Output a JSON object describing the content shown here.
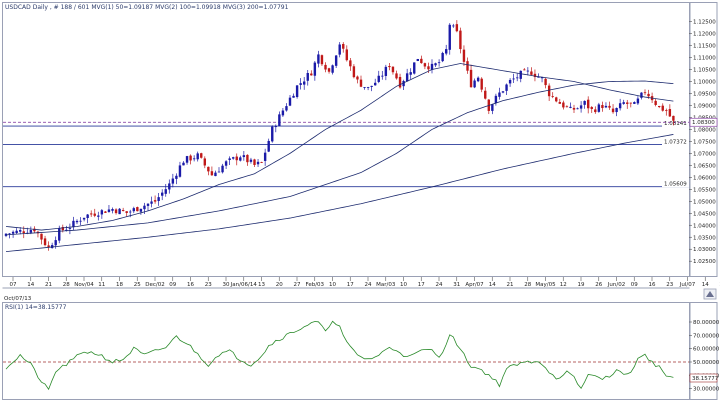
{
  "header": {
    "symbol": "USDCAD",
    "info": "Daily , # 188 / 601",
    "ma1": "MVG(1) 50=1.09187",
    "ma2": "MVG(2) 100=1.09918",
    "ma3": "MVG(3) 200=1.07791"
  },
  "colors": {
    "background": "#ffffff",
    "panel_border": "#9aa0b5",
    "up_candle": "#1a1aa8",
    "down_candle": "#c01818",
    "moving_average": "#1c2a6e",
    "support_line": "#2a3a9a",
    "current_price_dash": "#7a2a9a",
    "rsi_line": "#2a8a2a",
    "rsi_level_dash": "#a03030",
    "grid": "#d8dbe6"
  },
  "chart_data": [
    {
      "type": "candlestick",
      "name": "price",
      "ylim": [
        1.0205,
        1.129
      ],
      "y_ticks": [
        1.025,
        1.03,
        1.035,
        1.04,
        1.045,
        1.05,
        1.055,
        1.06,
        1.065,
        1.07,
        1.075,
        1.08,
        1.085,
        1.09,
        1.095,
        1.1,
        1.105,
        1.11,
        1.115,
        1.12,
        1.125
      ],
      "y_tick_labels": [
        "1.02500",
        "1.03000",
        "1.03500",
        "1.04000",
        "1.04500",
        "1.05000",
        "1.05500",
        "1.06000",
        "1.06500",
        "1.07000",
        "1.07500",
        "1.08000",
        "1.08500",
        "1.09000",
        "1.09500",
        "1.10000",
        "1.10500",
        "1.11000",
        "1.11500",
        "1.12000",
        "1.12500"
      ],
      "x_tick_labels": [
        "07",
        "14",
        "21",
        "28",
        "Nov/04",
        "11",
        "18",
        "25",
        "Dec/02",
        "09",
        "16",
        "23",
        "30",
        "Jan/06/14",
        "13",
        "20",
        "27",
        "Feb/03",
        "10",
        "17",
        "24",
        "Mar/03",
        "10",
        "17",
        "24",
        "31",
        "Apr/07",
        "14",
        "21",
        "28",
        "May/05",
        "12",
        "19",
        "26",
        "Jun/02",
        "09",
        "16",
        "23",
        "Jul/07",
        "14",
        "21",
        "28",
        "Aug/04"
      ],
      "x_tick_bar_spacing": 5,
      "x_range_label": "Oct/07/13",
      "grid": false,
      "last_price": 1.083,
      "last_price_label": "1.08300",
      "horizontal_levels": [
        {
          "value": 1.0814,
          "label": "1.08141"
        },
        {
          "value": 1.0737,
          "label": "1.07372"
        },
        {
          "value": 1.0561,
          "label": "1.05609"
        }
      ],
      "anchor_closes": [
        [
          0,
          1.0365
        ],
        [
          8,
          1.0385
        ],
        [
          12,
          1.0305
        ],
        [
          15,
          1.0375
        ],
        [
          18,
          1.0395
        ],
        [
          22,
          1.0438
        ],
        [
          26,
          1.0455
        ],
        [
          30,
          1.0468
        ],
        [
          34,
          1.0452
        ],
        [
          38,
          1.0478
        ],
        [
          42,
          1.05
        ],
        [
          46,
          1.057
        ],
        [
          50,
          1.067
        ],
        [
          54,
          1.069
        ],
        [
          58,
          1.061
        ],
        [
          62,
          1.066
        ],
        [
          66,
          1.069
        ],
        [
          70,
          1.065
        ],
        [
          72,
          1.066
        ],
        [
          75,
          1.08
        ],
        [
          78,
          1.088
        ],
        [
          82,
          1.098
        ],
        [
          86,
          1.104
        ],
        [
          88,
          1.111
        ],
        [
          91,
          1.104
        ],
        [
          94,
          1.116
        ],
        [
          96,
          1.109
        ],
        [
          99,
          1.1
        ],
        [
          102,
          1.097
        ],
        [
          105,
          1.101
        ],
        [
          108,
          1.107
        ],
        [
          111,
          1.099
        ],
        [
          114,
          1.105
        ],
        [
          116,
          1.11
        ],
        [
          118,
          1.107
        ],
        [
          120,
          1.106
        ],
        [
          122,
          1.108
        ],
        [
          124,
          1.113
        ],
        [
          125,
          1.124
        ],
        [
          127,
          1.12
        ],
        [
          129,
          1.108
        ],
        [
          131,
          1.099
        ],
        [
          133,
          1.102
        ],
        [
          136,
          1.089
        ],
        [
          139,
          1.095
        ],
        [
          142,
          1.1
        ],
        [
          145,
          1.103
        ],
        [
          148,
          1.104
        ],
        [
          151,
          1.101
        ],
        [
          153,
          1.095
        ],
        [
          156,
          1.091
        ],
        [
          159,
          1.088
        ],
        [
          161,
          1.089
        ],
        [
          163,
          1.091
        ],
        [
          165,
          1.088
        ],
        [
          168,
          1.09
        ],
        [
          171,
          1.087
        ],
        [
          174,
          1.091
        ],
        [
          177,
          1.09
        ],
        [
          180,
          1.096
        ],
        [
          182,
          1.093
        ],
        [
          184,
          1.089
        ],
        [
          186,
          1.088
        ],
        [
          188,
          1.083
        ]
      ],
      "moving_averages": [
        {
          "name": "MVG(1) 50",
          "anchors": [
            [
              0,
              1.0395
            ],
            [
              10,
              1.038
            ],
            [
              20,
              1.0395
            ],
            [
              30,
              1.042
            ],
            [
              40,
              1.046
            ],
            [
              50,
              1.051
            ],
            [
              60,
              1.057
            ],
            [
              70,
              1.0615
            ],
            [
              80,
              1.07
            ],
            [
              90,
              1.08
            ],
            [
              100,
              1.088
            ],
            [
              110,
              1.098
            ],
            [
              120,
              1.105
            ],
            [
              128,
              1.1075
            ],
            [
              134,
              1.106
            ],
            [
              140,
              1.1045
            ],
            [
              150,
              1.102
            ],
            [
              160,
              1.1
            ],
            [
              170,
              1.0965
            ],
            [
              180,
              1.0935
            ],
            [
              188,
              1.0918
            ]
          ]
        },
        {
          "name": "MVG(2) 100",
          "anchors": [
            [
              0,
              1.036
            ],
            [
              20,
              1.038
            ],
            [
              40,
              1.041
            ],
            [
              60,
              1.046
            ],
            [
              80,
              1.052
            ],
            [
              100,
              1.062
            ],
            [
              110,
              1.07
            ],
            [
              120,
              1.08
            ],
            [
              130,
              1.087
            ],
            [
              140,
              1.092
            ],
            [
              150,
              1.0955
            ],
            [
              160,
              1.0985
            ],
            [
              170,
              1.1
            ],
            [
              180,
              1.1002
            ],
            [
              188,
              1.0991
            ]
          ]
        },
        {
          "name": "MVG(3) 200",
          "anchors": [
            [
              0,
              1.029
            ],
            [
              20,
              1.032
            ],
            [
              40,
              1.035
            ],
            [
              60,
              1.0385
            ],
            [
              80,
              1.043
            ],
            [
              100,
              1.049
            ],
            [
              120,
              1.056
            ],
            [
              140,
              1.0635
            ],
            [
              160,
              1.07
            ],
            [
              175,
              1.0745
            ],
            [
              188,
              1.0779
            ]
          ]
        }
      ]
    },
    {
      "type": "line",
      "name": "RSI(1) 14=38.15777",
      "ylim": [
        23,
        92
      ],
      "y_ticks": [
        30,
        40,
        50,
        60,
        70,
        80
      ],
      "y_tick_labels": [
        "30.00000",
        "40.00000",
        "50.00000",
        "60.00000",
        "70.00000",
        "80.00000"
      ],
      "level": 50,
      "last_value_label": "38.15777",
      "anchors": [
        [
          0,
          46
        ],
        [
          4,
          55
        ],
        [
          7,
          48
        ],
        [
          10,
          35
        ],
        [
          12,
          29
        ],
        [
          14,
          43
        ],
        [
          18,
          50
        ],
        [
          22,
          58
        ],
        [
          26,
          56
        ],
        [
          30,
          50
        ],
        [
          33,
          52
        ],
        [
          36,
          60
        ],
        [
          39,
          55
        ],
        [
          42,
          58
        ],
        [
          45,
          61
        ],
        [
          48,
          69
        ],
        [
          51,
          64
        ],
        [
          54,
          56
        ],
        [
          57,
          48
        ],
        [
          60,
          56
        ],
        [
          63,
          58
        ],
        [
          66,
          52
        ],
        [
          69,
          48
        ],
        [
          72,
          55
        ],
        [
          74,
          62
        ],
        [
          76,
          66
        ],
        [
          79,
          70
        ],
        [
          82,
          74
        ],
        [
          85,
          78
        ],
        [
          88,
          80
        ],
        [
          90,
          72
        ],
        [
          92,
          82
        ],
        [
          94,
          76
        ],
        [
          96,
          64
        ],
        [
          99,
          55
        ],
        [
          102,
          52
        ],
        [
          105,
          55
        ],
        [
          108,
          61
        ],
        [
          111,
          58
        ],
        [
          113,
          53
        ],
        [
          116,
          57
        ],
        [
          119,
          60
        ],
        [
          122,
          55
        ],
        [
          124,
          62
        ],
        [
          125,
          71
        ],
        [
          127,
          64
        ],
        [
          129,
          55
        ],
        [
          131,
          47
        ],
        [
          134,
          44
        ],
        [
          137,
          38
        ],
        [
          139,
          33
        ],
        [
          141,
          45
        ],
        [
          144,
          48
        ],
        [
          147,
          50
        ],
        [
          150,
          51
        ],
        [
          152,
          46
        ],
        [
          154,
          40
        ],
        [
          156,
          37
        ],
        [
          158,
          42
        ],
        [
          160,
          38
        ],
        [
          162,
          30
        ],
        [
          164,
          40
        ],
        [
          166,
          41
        ],
        [
          168,
          36
        ],
        [
          170,
          40
        ],
        [
          172,
          44
        ],
        [
          174,
          40
        ],
        [
          176,
          43
        ],
        [
          178,
          52
        ],
        [
          180,
          55
        ],
        [
          182,
          50
        ],
        [
          184,
          46
        ],
        [
          186,
          40
        ],
        [
          188,
          38
        ]
      ]
    }
  ]
}
